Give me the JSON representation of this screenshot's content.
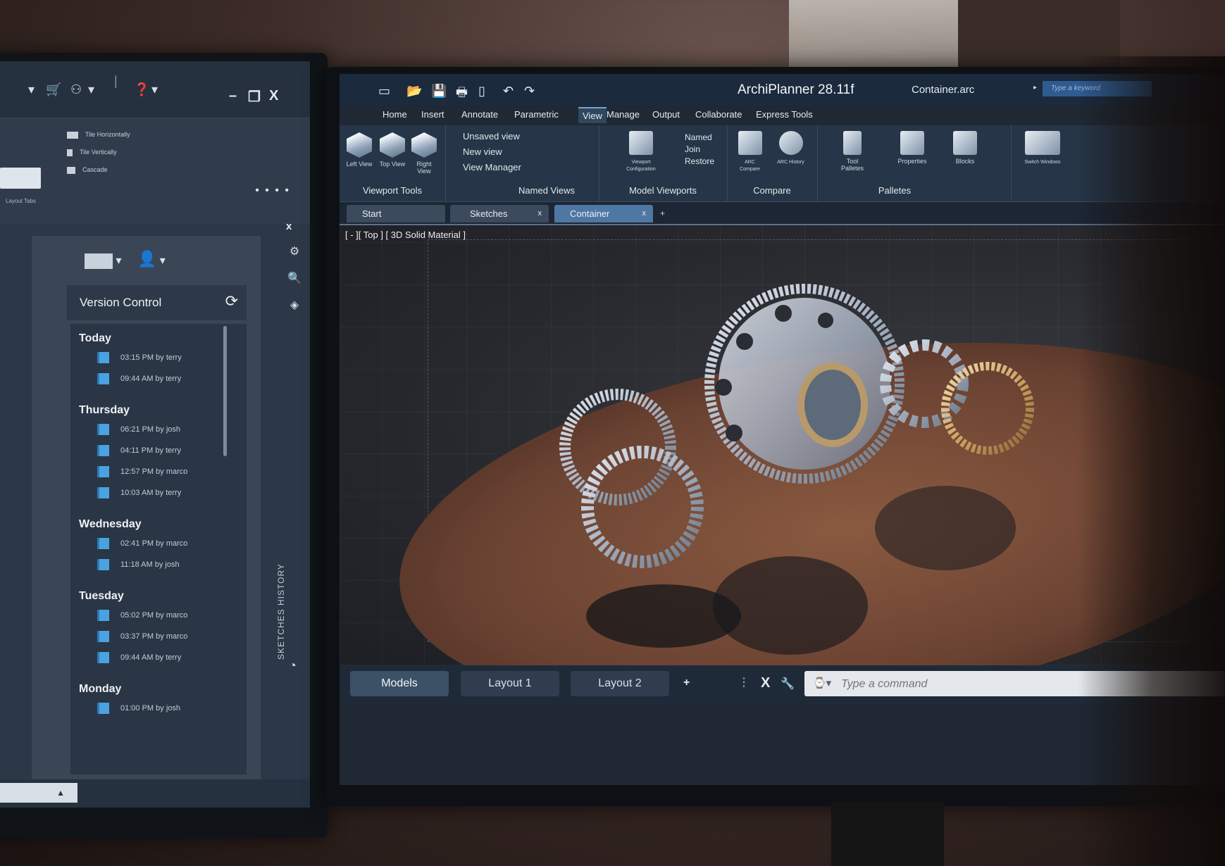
{
  "left_panel": {
    "tile_options": [
      "Tile Horizontally",
      "Tile Vertically",
      "Cascade"
    ],
    "layout_tabs_label": "Layout Tabs",
    "window_controls": {
      "minimize": "–",
      "restore": "❐",
      "close": "X"
    },
    "close_panel": "x",
    "more": "• • • •",
    "version_control_title": "Version Control",
    "sketches_history_label": "SKETCHES HISTORY",
    "history": [
      {
        "day": "Today",
        "entries": [
          "03:15 PM by terry",
          "09:44 AM by terry"
        ]
      },
      {
        "day": "Thursday",
        "entries": [
          "06:21 PM by josh",
          "04:11 PM by terry",
          "12:57 PM by marco",
          "10:03 AM by terry"
        ]
      },
      {
        "day": "Wednesday",
        "entries": [
          "02:41 PM by marco",
          "11:18 AM by josh"
        ]
      },
      {
        "day": "Tuesday",
        "entries": [
          "05:02 PM by marco",
          "03:37 PM by marco",
          "09:44 AM by terry"
        ]
      },
      {
        "day": "Monday",
        "entries": [
          "01:00 PM by josh"
        ]
      }
    ]
  },
  "app": {
    "title": "ArchiPlanner 28.11f",
    "document": "Container.arc",
    "search_placeholder": "Type a keyword",
    "menu": [
      "Home",
      "Insert",
      "Annotate",
      "Parametric",
      "View",
      "Manage",
      "Output",
      "Collaborate",
      "Express Tools"
    ],
    "active_menu": "View",
    "ribbon": {
      "viewport_tools": {
        "label": "Viewport Tools",
        "buttons": [
          "Left View",
          "Top View",
          "Right View"
        ]
      },
      "named_views": {
        "label": "Named Views",
        "items": [
          "Unsaved view",
          "New view",
          "View Manager"
        ]
      },
      "model_viewports": {
        "label": "Model Viewports",
        "button": "Viewport Configuration",
        "items": [
          "Named",
          "Join",
          "Restore"
        ]
      },
      "compare": {
        "label": "Compare",
        "buttons": [
          "ARC Compare",
          "ARC History"
        ]
      },
      "palletes": {
        "label": "Palletes",
        "buttons": [
          "Tool Palletes",
          "Properties"
        ]
      },
      "blocks": "Blocks",
      "switch_windows": "Switch Windows"
    },
    "doc_tabs": [
      {
        "label": "Start",
        "closable": false
      },
      {
        "label": "Sketches",
        "closable": true
      },
      {
        "label": "Container",
        "closable": true
      }
    ],
    "active_doc_tab": "Container",
    "viewport_label": "[ - ][ Top ] [ 3D Solid Material ]",
    "layout_tabs": [
      "Models",
      "Layout 1",
      "Layout 2"
    ],
    "active_layout": "Models",
    "command_placeholder": "Type a command",
    "close_symbol": "x",
    "add_symbol": "+",
    "cancel_symbol": "X",
    "accent_color": "#4f77a3"
  }
}
